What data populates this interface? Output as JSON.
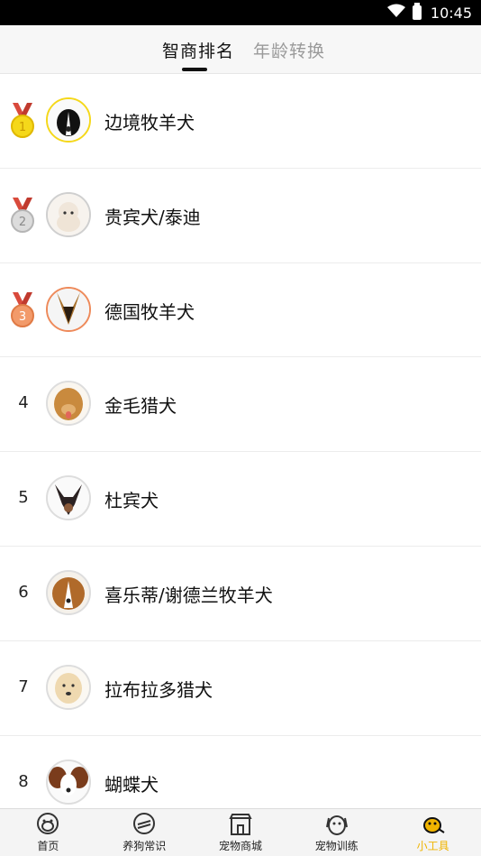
{
  "status_bar": {
    "time": "10:45"
  },
  "tabs": [
    {
      "label": "智商排名",
      "active": true
    },
    {
      "label": "年龄转换",
      "active": false
    }
  ],
  "ranking": [
    {
      "rank": "1",
      "name": "边境牧羊犬",
      "medal": "gold"
    },
    {
      "rank": "2",
      "name": "贵宾犬/泰迪",
      "medal": "silver"
    },
    {
      "rank": "3",
      "name": "德国牧羊犬",
      "medal": "bronze"
    },
    {
      "rank": "4",
      "name": "金毛猎犬",
      "medal": null
    },
    {
      "rank": "5",
      "name": "杜宾犬",
      "medal": null
    },
    {
      "rank": "6",
      "name": "喜乐蒂/谢德兰牧羊犬",
      "medal": null
    },
    {
      "rank": "7",
      "name": "拉布拉多猎犬",
      "medal": null
    },
    {
      "rank": "8",
      "name": "蝴蝶犬",
      "medal": null
    }
  ],
  "colors": {
    "gold": "#f5d81a",
    "silver": "#cfcfcf",
    "bronze": "#ee8a5a",
    "ribbon": "#d94a3c",
    "active_nav": "#f0b400"
  },
  "bottom_nav": [
    {
      "label": "首页",
      "icon": "home-icon",
      "active": false
    },
    {
      "label": "养狗常识",
      "icon": "bone-book-icon",
      "active": false
    },
    {
      "label": "宠物商城",
      "icon": "shop-icon",
      "active": false
    },
    {
      "label": "宠物训练",
      "icon": "dog-face-icon",
      "active": false
    },
    {
      "label": "小工具",
      "icon": "dog-tools-icon",
      "active": true
    }
  ]
}
